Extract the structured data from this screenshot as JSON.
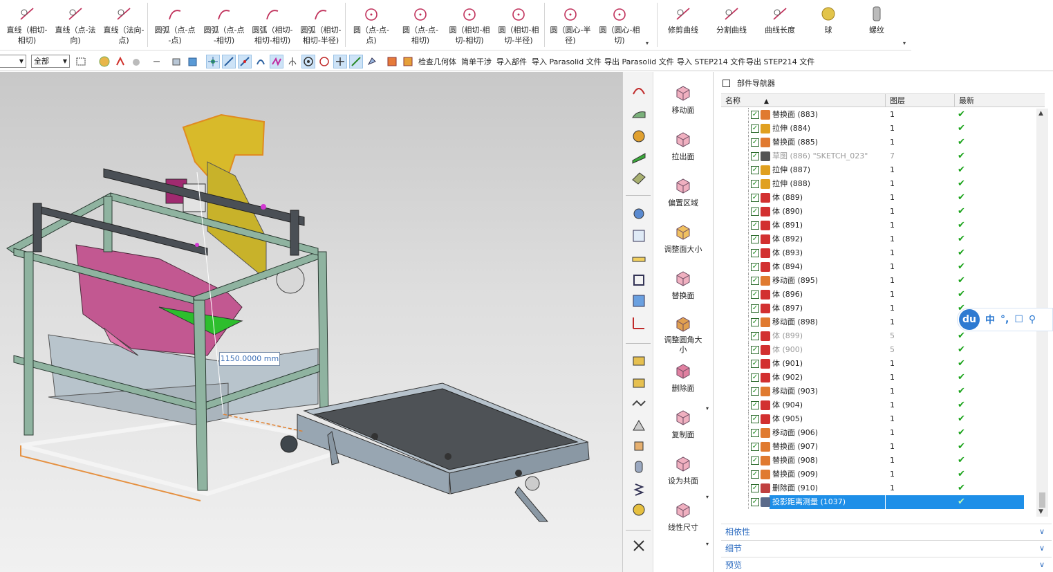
{
  "ribbon": {
    "buttons": [
      {
        "label": "直线（相切-\n相切)",
        "icon": "line-tangent-icon"
      },
      {
        "label": "直线（点-法\n向)",
        "icon": "line-point-normal-icon"
      },
      {
        "label": "直线（法向-\n点)",
        "icon": "line-normal-point-icon"
      },
      {
        "label": "圆弧（点-点\n-点)",
        "icon": "arc-3point-icon"
      },
      {
        "label": "圆弧（点-点\n-相切)",
        "icon": "arc-point-tangent-icon"
      },
      {
        "label": "圆弧（相切-\n相切-相切)",
        "icon": "arc-3tangent-icon"
      },
      {
        "label": "圆弧（相切-\n相切-半径)",
        "icon": "arc-tangent-radius-icon"
      },
      {
        "label": "圆（点-点-\n点)",
        "icon": "circle-3point-icon"
      },
      {
        "label": "圆（点-点-\n相切)",
        "icon": "circle-point-tangent-icon"
      },
      {
        "label": "圆（相切-相\n切-相切)",
        "icon": "circle-3tangent-icon"
      },
      {
        "label": "圆（相切-相\n切-半径)",
        "icon": "circle-tangent-radius-icon"
      },
      {
        "label": "圆（圆心-半\n径)",
        "icon": "circle-center-radius-icon"
      },
      {
        "label": "圆（圆心-相\n切)",
        "icon": "circle-center-tangent-icon"
      },
      {
        "label": "修剪曲线",
        "icon": "trim-curve-icon"
      },
      {
        "label": "分割曲线",
        "icon": "divide-curve-icon"
      },
      {
        "label": "曲线长度",
        "icon": "curve-length-icon"
      },
      {
        "label": "球",
        "icon": "sphere-icon"
      },
      {
        "label": "螺纹",
        "icon": "thread-icon"
      }
    ]
  },
  "toolbar2": {
    "filter_value": "全部",
    "links": [
      "检查几何体",
      "简单干涉",
      "导入部件",
      "导入 Parasolid 文件",
      "导出 Parasolid 文件",
      "导入 STEP214 文件",
      "导出 STEP214 文件"
    ]
  },
  "viewport": {
    "measure_label": "1150.0000 mm"
  },
  "feature_panel": {
    "buttons": [
      {
        "label": "移动面",
        "icon": "move-face-icon"
      },
      {
        "label": "拉出面",
        "icon": "pull-face-icon"
      },
      {
        "label": "偏置区域",
        "icon": "offset-region-icon"
      },
      {
        "label": "调整面大小",
        "icon": "resize-face-icon"
      },
      {
        "label": "替换面",
        "icon": "replace-face-icon"
      },
      {
        "label": "调整圆角大\n小",
        "icon": "resize-blend-icon"
      },
      {
        "label": "删除面",
        "icon": "delete-face-icon"
      },
      {
        "label": "复制面",
        "icon": "copy-face-icon"
      },
      {
        "label": "设为共面",
        "icon": "make-coplanar-icon"
      },
      {
        "label": "线性尺寸",
        "icon": "linear-dimension-icon"
      }
    ]
  },
  "navigator": {
    "title": "部件导航器",
    "columns": [
      "名称",
      "图层",
      "最新"
    ],
    "rows": [
      {
        "name": "替换面 (883)",
        "layer": "1",
        "icon": "replace",
        "gray": false
      },
      {
        "name": "拉伸 (884)",
        "layer": "1",
        "icon": "extrude",
        "gray": false
      },
      {
        "name": "替换面 (885)",
        "layer": "1",
        "icon": "replace",
        "gray": false
      },
      {
        "name": "草图 (886) \"SKETCH_023\"",
        "layer": "7",
        "icon": "sketch",
        "gray": true
      },
      {
        "name": "拉伸 (887)",
        "layer": "1",
        "icon": "extrude",
        "gray": false
      },
      {
        "name": "拉伸 (888)",
        "layer": "1",
        "icon": "extrude",
        "gray": false
      },
      {
        "name": "体 (889)",
        "layer": "1",
        "icon": "body",
        "gray": false
      },
      {
        "name": "体 (890)",
        "layer": "1",
        "icon": "body",
        "gray": false
      },
      {
        "name": "体 (891)",
        "layer": "1",
        "icon": "body",
        "gray": false
      },
      {
        "name": "体 (892)",
        "layer": "1",
        "icon": "body",
        "gray": false
      },
      {
        "name": "体 (893)",
        "layer": "1",
        "icon": "body",
        "gray": false
      },
      {
        "name": "体 (894)",
        "layer": "1",
        "icon": "body",
        "gray": false
      },
      {
        "name": "移动面 (895)",
        "layer": "1",
        "icon": "move",
        "gray": false
      },
      {
        "name": "体 (896)",
        "layer": "1",
        "icon": "body",
        "gray": false
      },
      {
        "name": "体 (897)",
        "layer": "1",
        "icon": "body",
        "gray": false
      },
      {
        "name": "移动面 (898)",
        "layer": "1",
        "icon": "move",
        "gray": false
      },
      {
        "name": "体 (899)",
        "layer": "5",
        "icon": "body",
        "gray": true
      },
      {
        "name": "体 (900)",
        "layer": "5",
        "icon": "body",
        "gray": true
      },
      {
        "name": "体 (901)",
        "layer": "1",
        "icon": "body",
        "gray": false
      },
      {
        "name": "体 (902)",
        "layer": "1",
        "icon": "body",
        "gray": false
      },
      {
        "name": "移动面 (903)",
        "layer": "1",
        "icon": "move",
        "gray": false
      },
      {
        "name": "体 (904)",
        "layer": "1",
        "icon": "body",
        "gray": false
      },
      {
        "name": "体 (905)",
        "layer": "1",
        "icon": "body",
        "gray": false
      },
      {
        "name": "移动面 (906)",
        "layer": "1",
        "icon": "move",
        "gray": false
      },
      {
        "name": "替换面 (907)",
        "layer": "1",
        "icon": "replace",
        "gray": false
      },
      {
        "name": "替换面 (908)",
        "layer": "1",
        "icon": "replace",
        "gray": false
      },
      {
        "name": "替换面 (909)",
        "layer": "1",
        "icon": "replace",
        "gray": false
      },
      {
        "name": "删除面 (910)",
        "layer": "1",
        "icon": "delete",
        "gray": false
      },
      {
        "name": "投影距离测量 (1037)",
        "layer": "",
        "icon": "measure",
        "gray": false,
        "selected": true
      }
    ],
    "sections": [
      "相依性",
      "细节",
      "预览"
    ]
  },
  "ime": {
    "logo": "du",
    "items": [
      "中",
      "°,",
      "☐",
      "⚲"
    ]
  },
  "colors": {
    "selection": "#1e8fe8",
    "check_green": "#1aa31a",
    "link_blue": "#2d6cc0"
  }
}
